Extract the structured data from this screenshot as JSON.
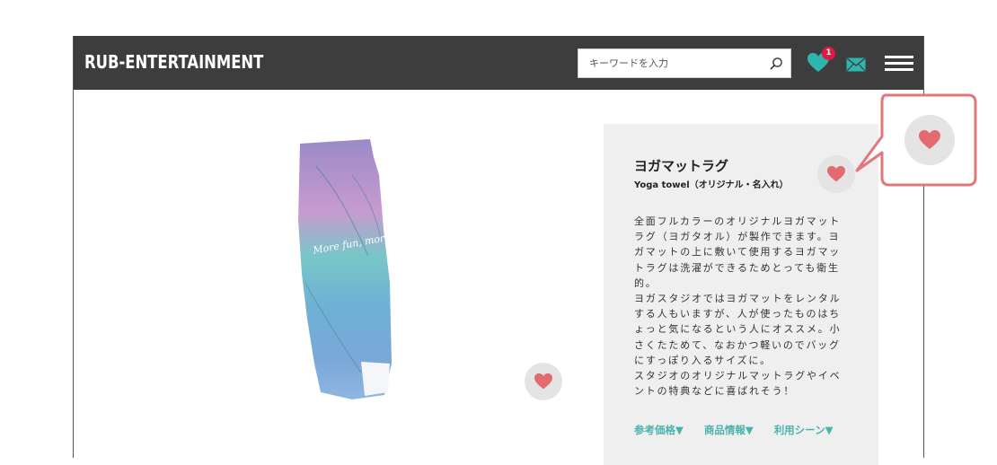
{
  "header": {
    "logo": "RUB-ENTERTAINMENT",
    "search_placeholder": "キーワードを入力",
    "favorites_count": "1",
    "colors": {
      "bar": "#3d3d3d",
      "accent": "#2fb5ad",
      "badge": "#e0193f"
    },
    "icons": [
      "search-icon",
      "heart-icon",
      "mail-icon",
      "menu-icon"
    ]
  },
  "product": {
    "image_text": "More fun, more Connected!",
    "title": "ヨガマットラグ",
    "subtitle": "Yoga towel（オリジナル・名入れ）",
    "description": "全面フルカラーのオリジナルヨガマット\nラグ（ヨガタオル）が製作できます。ヨ\nガマットの上に敷いて使用するヨガマッ\nトラグは洗濯ができるためとっても衛生\n的。\nヨガスタジオではヨガマットをレンタル\nする人もいますが、人が使ったものはち\nょっと気になるという人にオススメ。小\nさくたためて、なおかつ軽いのでバッグ\nにすっぽり入るサイズに。\nスタジオのオリジナルマットラグやイベ\nントの特典などに喜ばれそう！",
    "tabs": [
      "参考価格▼",
      "商品情報▼",
      "利用シーン▼"
    ],
    "colors": {
      "panel": "#efefef",
      "heart": "#e36b70",
      "tab_text": "#4bb3ad"
    }
  }
}
